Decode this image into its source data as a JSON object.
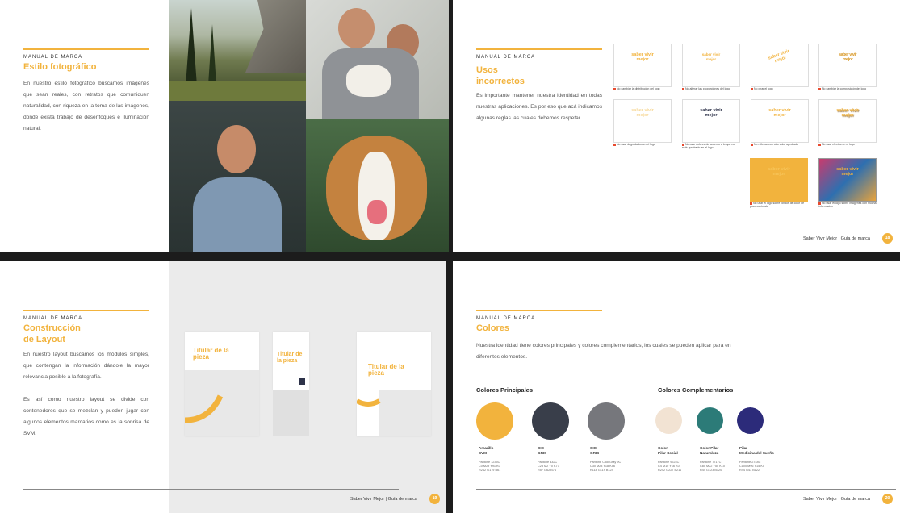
{
  "colors": {
    "accent": "#f2b33d",
    "navy": "#2d3249",
    "sand": "#f2e3d3",
    "teal": "#2c7b78",
    "indigo": "#2c2b7a",
    "gray_dark": "#393e4a",
    "gray_light": "#76777c"
  },
  "page1": {
    "kicker": "MANUAL DE MARCA",
    "title": "Estilo fotográfico",
    "body": "En nuestro estilo fotográfico buscamos imágenes que sean reales, con retratos que comuniquen naturalidad, con riqueza en la toma de las imágenes, donde exista trabajo de desenfoques e iluminación natural."
  },
  "page2": {
    "kicker": "MANUAL DE MARCA",
    "title_l1": "Usos",
    "title_l2": "incorrectos",
    "body": "Es importante mantener nuestra identidad en todas nuestras aplicaciones. Es por eso que acá indicamos algunas reglas las cuales debemos respetar.",
    "logo_text": "saber vivir mejor",
    "captions": [
      "No cambiar la distribución del logo",
      "No alterar las proporciones del logo",
      "No girar el logo",
      "No cambiar la composición del logo",
      "No usar degradados en el logo",
      "No usar colores de acuerdo a lo que no está aprobado en el logo",
      "No rellenar con otro color aprobado",
      "No usar efectos en el logo",
      "No usar el logo sobre fondos de color de poco contraste",
      "No usar el logo sobre imágenes con mucha información"
    ],
    "footer": "Saber Vivir Mejor | Guía de marca",
    "page_number": "18"
  },
  "page3": {
    "kicker": "MANUAL DE MARCA",
    "title_l1": "Construcción",
    "title_l2": "de Layout",
    "body1": "En nuestro layout buscamos los módulos simples, que contengan la información dándole la mayor relevancia posible a la fotografía.",
    "body2": "Es así como nuestro layout se divide con contenedores que se mezclan y pueden jugar con algunos elementos marcarios como es la sonrisa de SVM.",
    "card_title": "Titular de la pieza",
    "footer": "Saber Vivir Mejor | Guía de marca",
    "page_number": "19"
  },
  "page4": {
    "kicker": "MANUAL DE MARCA",
    "title": "Colores",
    "body": "Nuestra identidad tiene colores principales y colores complementarios, los cuales se pueden aplicar para en diferentes elementos.",
    "principales_title": "Colores Principales",
    "complementarios_title": "Colores Complementarios",
    "principales": [
      {
        "name1": "Amarillo",
        "name2": "SVM",
        "code": "Pantone 1235C\nC0 M29 Y91 K0\nR242 G179 B61",
        "hex": "#f2b33d"
      },
      {
        "name1": "CIC",
        "name2": "GRIS",
        "code": "Pantone 432C\nC23 M2 Y0 K77\nR57 G62 B74",
        "hex": "#393e4a"
      },
      {
        "name1": "CIC",
        "name2": "GRIS",
        "code": "Pantone Cool Gray 9C\nC30 M23 Y18 K56\nR118 G119 B124",
        "hex": "#76777c"
      }
    ],
    "complementarios": [
      {
        "name1": "Color",
        "name2": "Pilar Social",
        "code": "Pantone 9224C\nC4 M10 Y16 K0\nR242 G227 B211",
        "hex": "#f2e3d3"
      },
      {
        "name1": "Color Pilar",
        "name2": "Naturaleza",
        "code": "Pantone 7717C\nC85 M22 Y50 K10\nR44 G123 B120",
        "hex": "#2c7b78"
      },
      {
        "name1": "Pilar",
        "name2": "Medicina del Sueño",
        "code": "Pantone 2748C\nC100 M96 Y15 K5\nR44 G43 B122",
        "hex": "#2c2b7a"
      }
    ],
    "footer": "Saber Vivir Mejor | Guía de marca",
    "page_number": "20"
  }
}
